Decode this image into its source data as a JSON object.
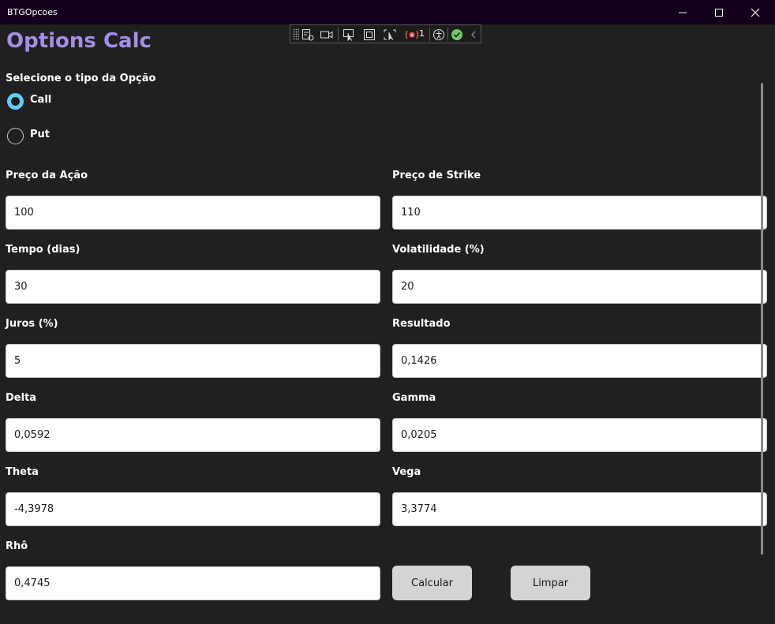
{
  "window": {
    "title": "BTGOpcoes",
    "controls": [
      "minimize-icon",
      "maximize-icon",
      "close-icon"
    ]
  },
  "debug_toolbar": {
    "icons": [
      "grip-icon",
      "live-visual-tree-icon",
      "video-icon",
      "select-element-icon",
      "display-layout-adorners-icon",
      "track-focus-icon",
      "binding-failures-icon",
      "accessibility-icon",
      "checkmark-icon",
      "collapse-chevron-icon"
    ],
    "binding_failure_count": "1",
    "accent": "#e05555",
    "check_color": "#6ccb5f"
  },
  "app_title": "Options Calc",
  "app_title_color": "#a58ee6",
  "option_type": {
    "label": "Selecione o tipo da Opção",
    "options": [
      {
        "label": "Call",
        "selected": true
      },
      {
        "label": "Put",
        "selected": false
      }
    ],
    "selected_color": "#60cdff"
  },
  "fields": {
    "preco_acao": {
      "label": "Preço da Ação",
      "value": "100"
    },
    "preco_strike": {
      "label": "Preço de Strike",
      "value": "110"
    },
    "tempo": {
      "label": "Tempo (dias)",
      "value": "30"
    },
    "volatilidade": {
      "label": "Volatilidade (%)",
      "value": "20"
    },
    "juros": {
      "label": "Juros (%)",
      "value": "5"
    },
    "resultado": {
      "label": "Resultado",
      "value": "0,1426"
    },
    "delta": {
      "label": "Delta",
      "value": "0,0592"
    },
    "gamma": {
      "label": "Gamma",
      "value": "0,0205"
    },
    "theta": {
      "label": "Theta",
      "value": "-4,3978"
    },
    "vega": {
      "label": "Vega",
      "value": "3,3774"
    },
    "rho": {
      "label": "Rhô",
      "value": "0,4745"
    }
  },
  "buttons": {
    "calcular": "Calcular",
    "limpar": "Limpar"
  }
}
